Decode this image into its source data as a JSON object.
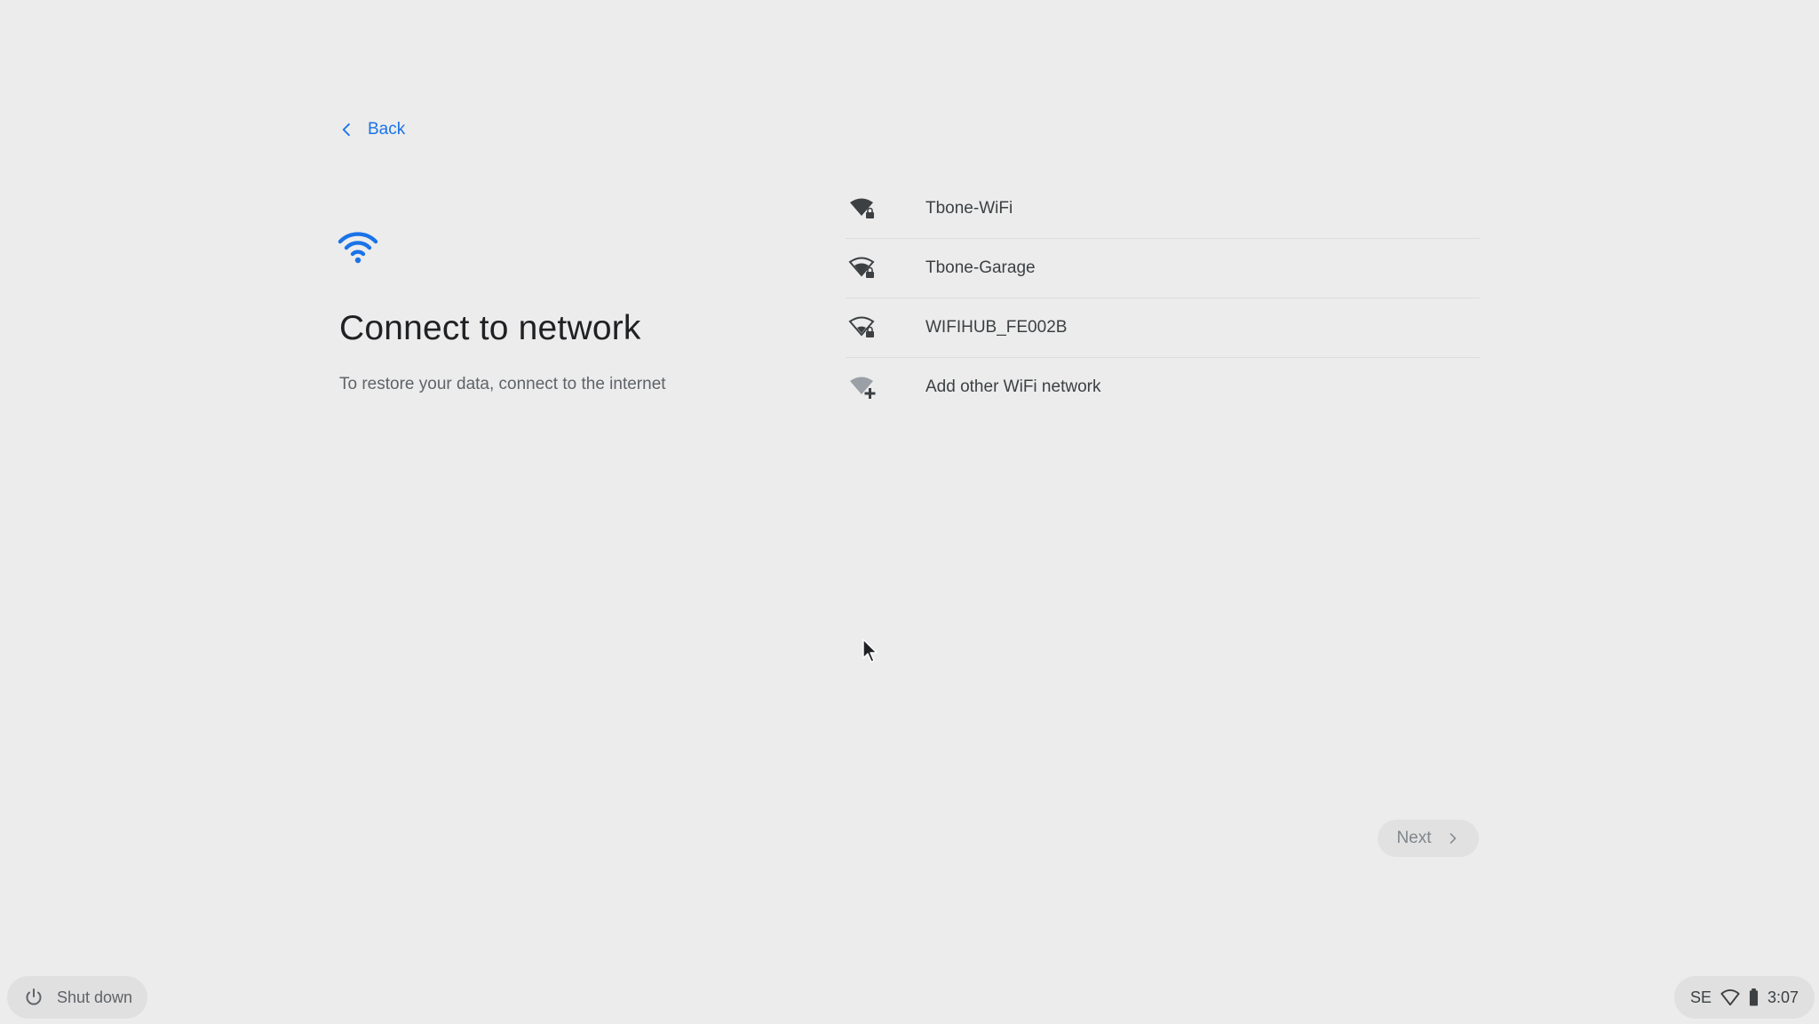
{
  "header": {
    "back_label": "Back"
  },
  "main": {
    "title": "Connect to network",
    "subtitle": "To restore your data, connect to the internet"
  },
  "networks": [
    {
      "label": "Tbone-WiFi",
      "icon": "wifi-secured-icon"
    },
    {
      "label": "Tbone-Garage",
      "icon": "wifi-secured-icon"
    },
    {
      "label": "WIFIHUB_FE002B",
      "icon": "wifi-secured-icon"
    },
    {
      "label": "Add other WiFi network",
      "icon": "wifi-add-icon"
    }
  ],
  "footer": {
    "next_label": "Next",
    "shutdown_label": "Shut down"
  },
  "tray": {
    "locale": "SE",
    "time": "3:07"
  },
  "colors": {
    "accent": "#1a73e8",
    "background": "#ececec"
  }
}
